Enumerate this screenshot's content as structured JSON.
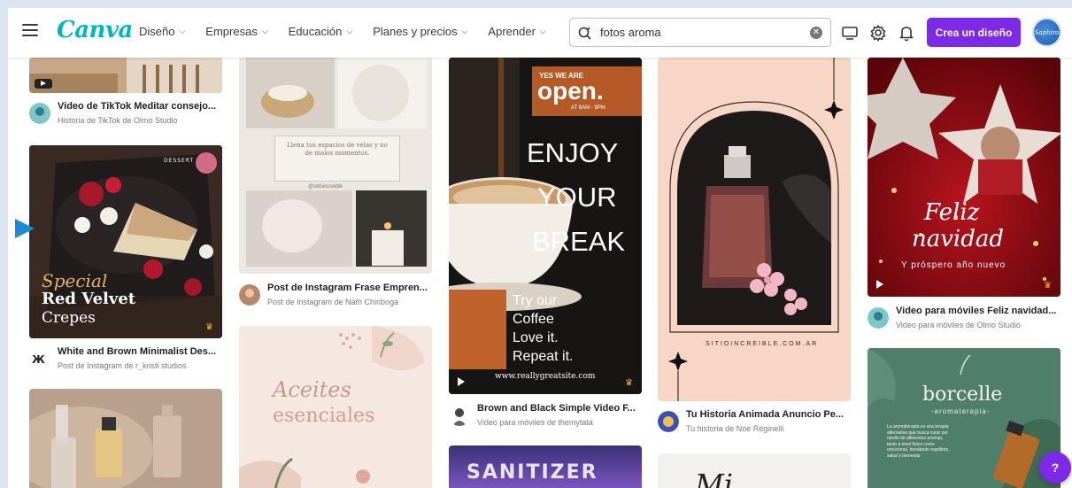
{
  "app": {
    "logo": "Canva"
  },
  "nav": {
    "items": [
      {
        "label": "Diseño"
      },
      {
        "label": "Empresas"
      },
      {
        "label": "Educación"
      },
      {
        "label": "Planes y precios"
      },
      {
        "label": "Aprender"
      }
    ]
  },
  "search": {
    "value": "fotos aroma",
    "placeholder": ""
  },
  "toolbar": {
    "create_label": "Crea un diseño",
    "avatar_text": "Saphira"
  },
  "help_label": "?",
  "templates": {
    "tiktok_meditar": {
      "title": "Video de TikTok Meditar consejo...",
      "subtitle": "Historia de TikTok de Olmo Studio"
    },
    "red_velvet": {
      "title": "White and Brown Minimalist Des...",
      "subtitle": "Post de Instagram de r_kristi studios",
      "text_special": "Special",
      "text_main": "Red Velvet",
      "text_sub": "Crepes",
      "text_brand": "DESSERT"
    },
    "post_velas": {
      "title": "Post de Instagram Frase Empren...",
      "subtitle": "Post de Instagram de Nath Chiriboga",
      "quote": "Llena tus espacios de velas y no de malos momentos.",
      "handle": "@sitioincreible"
    },
    "aceites": {
      "title_line1": "Aceites",
      "title_line2": "esenciales"
    },
    "coffee": {
      "title": "Brown and Black Simple Video F...",
      "subtitle": "Video para móviles de themytata",
      "badge_small": "YES WE ARE",
      "badge_big": "open.",
      "badge_time": "AT 8AM - 9PM",
      "line1": "ENJOY",
      "line2": "YOUR",
      "line3": "BREAK",
      "try1": "Try our",
      "try2": "Coffee",
      "try3": "Love it.",
      "try4": "Repeat it.",
      "site": "www.reallygreatsite.com"
    },
    "sanitizer": {
      "text": "SANITIZER"
    },
    "perfume": {
      "title": "Tu Historia Animada Anuncio Pe...",
      "subtitle": "Tu historia de Noe Reginelli",
      "site": "SITIOINCREIBLE.COM.AR"
    },
    "mi": {
      "text": "Mi"
    },
    "navidad": {
      "title": "Video para móviles Feliz navidad...",
      "subtitle": "Video para móviles de Olmo Studio",
      "line1": "Feliz",
      "line2": "navidad",
      "line3": "Y próspero año nuevo"
    },
    "borcelle": {
      "brand": "borcelle",
      "tag": "-aromaterapia-",
      "desc": "La aromaterapia es una terapia alternativa que busca curar por medio de diferentes aromas, tanto a nivel físico como emocional, brindando equilibrio, salud y bienestar."
    }
  },
  "colors": {
    "accent": "#7d2ae8",
    "brand": "#00b6c6"
  }
}
